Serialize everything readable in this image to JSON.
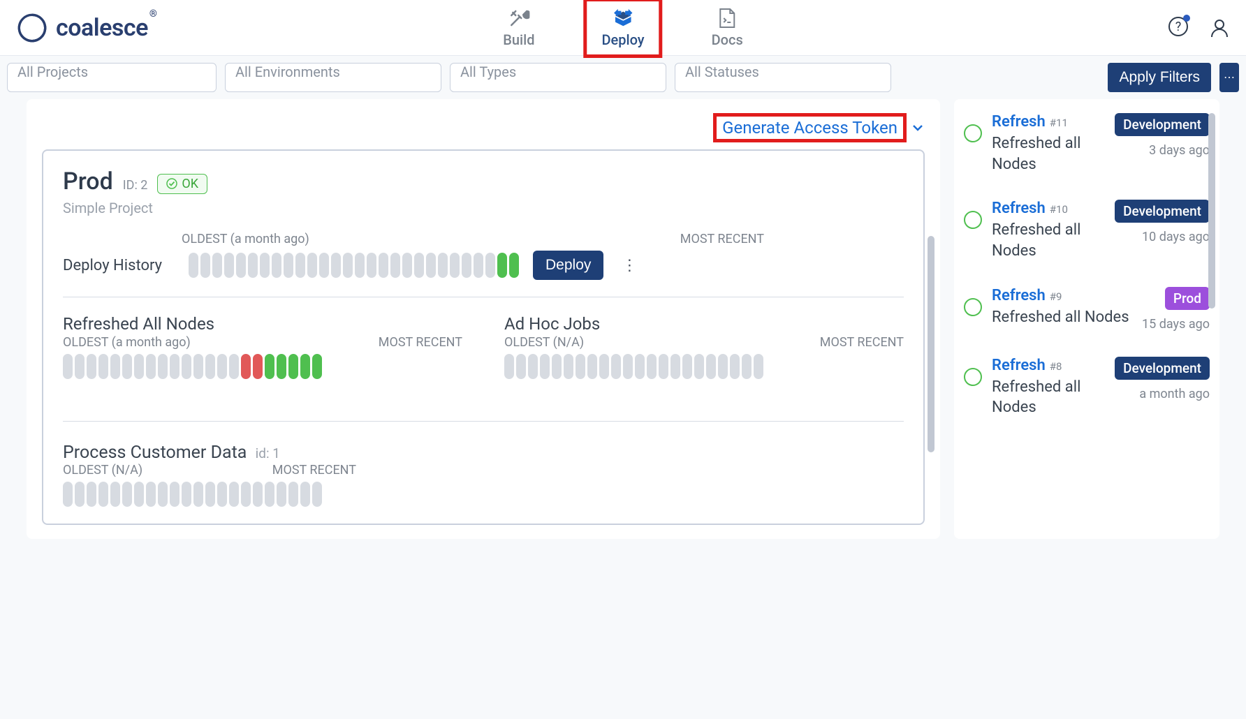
{
  "brand": "coalesce",
  "nav": {
    "build": "Build",
    "deploy": "Deploy",
    "docs": "Docs"
  },
  "filters": {
    "projects": "All Projects",
    "environments": "All Environments",
    "types": "All Types",
    "statuses": "All Statuses",
    "apply": "Apply Filters"
  },
  "main": {
    "generate_token": "Generate Access Token",
    "env": {
      "name": "Prod",
      "id": "ID: 2",
      "ok": "OK",
      "project": "Simple Project"
    },
    "deploy_history": {
      "title": "Deploy History",
      "oldest": "OLDEST (a month ago)",
      "recent": "MOST RECENT",
      "deploy_btn": "Deploy",
      "bars": [
        "n",
        "n",
        "n",
        "n",
        "n",
        "n",
        "n",
        "n",
        "n",
        "n",
        "n",
        "n",
        "n",
        "n",
        "n",
        "n",
        "n",
        "n",
        "n",
        "n",
        "n",
        "n",
        "n",
        "n",
        "n",
        "n",
        "g",
        "g"
      ]
    },
    "refreshed": {
      "title": "Refreshed All Nodes",
      "oldest": "OLDEST (a month ago)",
      "recent": "MOST RECENT",
      "bars": [
        "n",
        "n",
        "n",
        "n",
        "n",
        "n",
        "n",
        "n",
        "n",
        "n",
        "n",
        "n",
        "n",
        "n",
        "n",
        "r",
        "r",
        "g",
        "g",
        "g",
        "g",
        "g"
      ]
    },
    "adhoc": {
      "title": "Ad Hoc Jobs",
      "oldest": "OLDEST (N/A)",
      "recent": "MOST RECENT",
      "bars": [
        "n",
        "n",
        "n",
        "n",
        "n",
        "n",
        "n",
        "n",
        "n",
        "n",
        "n",
        "n",
        "n",
        "n",
        "n",
        "n",
        "n",
        "n",
        "n",
        "n",
        "n",
        "n"
      ]
    },
    "process": {
      "title": "Process Customer Data",
      "id": "id: 1",
      "oldest": "OLDEST (N/A)",
      "recent": "MOST RECENT",
      "bars": [
        "n",
        "n",
        "n",
        "n",
        "n",
        "n",
        "n",
        "n",
        "n",
        "n",
        "n",
        "n",
        "n",
        "n",
        "n",
        "n",
        "n",
        "n",
        "n",
        "n",
        "n",
        "n"
      ]
    }
  },
  "sidebar": [
    {
      "action": "Refresh",
      "num": "#11",
      "desc": "Refreshed all Nodes",
      "env": "Development",
      "env_type": "dev",
      "time": "3 days ago"
    },
    {
      "action": "Refresh",
      "num": "#10",
      "desc": "Refreshed all Nodes",
      "env": "Development",
      "env_type": "dev",
      "time": "10 days ago"
    },
    {
      "action": "Refresh",
      "num": "#9",
      "desc": "Refreshed all Nodes",
      "env": "Prod",
      "env_type": "prod",
      "time": "15 days ago"
    },
    {
      "action": "Refresh",
      "num": "#8",
      "desc": "Refreshed all Nodes",
      "env": "Development",
      "env_type": "dev",
      "time": "a month ago"
    }
  ]
}
